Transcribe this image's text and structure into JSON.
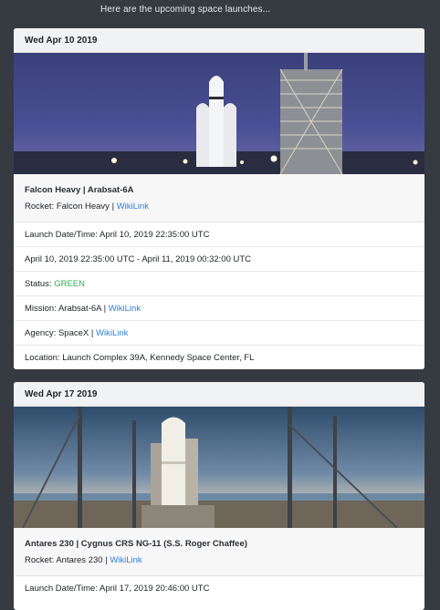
{
  "intro": "Here are the upcoming space launches...",
  "launches": [
    {
      "date": "Wed Apr 10 2019",
      "title": "Falcon Heavy | Arabsat-6A",
      "rocket_prefix": "Rocket: Falcon Heavy | ",
      "wiki": "WikiLink",
      "launch_time": "Launch Date/Time: April 10, 2019 22:35:00 UTC",
      "window": "April 10, 2019 22:35:00 UTC - April 11, 2019 00:32:00 UTC",
      "status_prefix": "Status: ",
      "status_value": "GREEN",
      "mission_prefix": "Mission: Arabsat-6A | ",
      "agency_prefix": "Agency: SpaceX | ",
      "location": "Location: Launch Complex 39A, Kennedy Space Center, FL"
    },
    {
      "date": "Wed Apr 17 2019",
      "title": "Antares 230 | Cygnus CRS NG-11 (S.S. Roger Chaffee)",
      "rocket_prefix": "Rocket: Antares 230 | ",
      "wiki": "WikiLink",
      "launch_time": "Launch Date/Time: April 17, 2019 20:46:00 UTC"
    }
  ]
}
